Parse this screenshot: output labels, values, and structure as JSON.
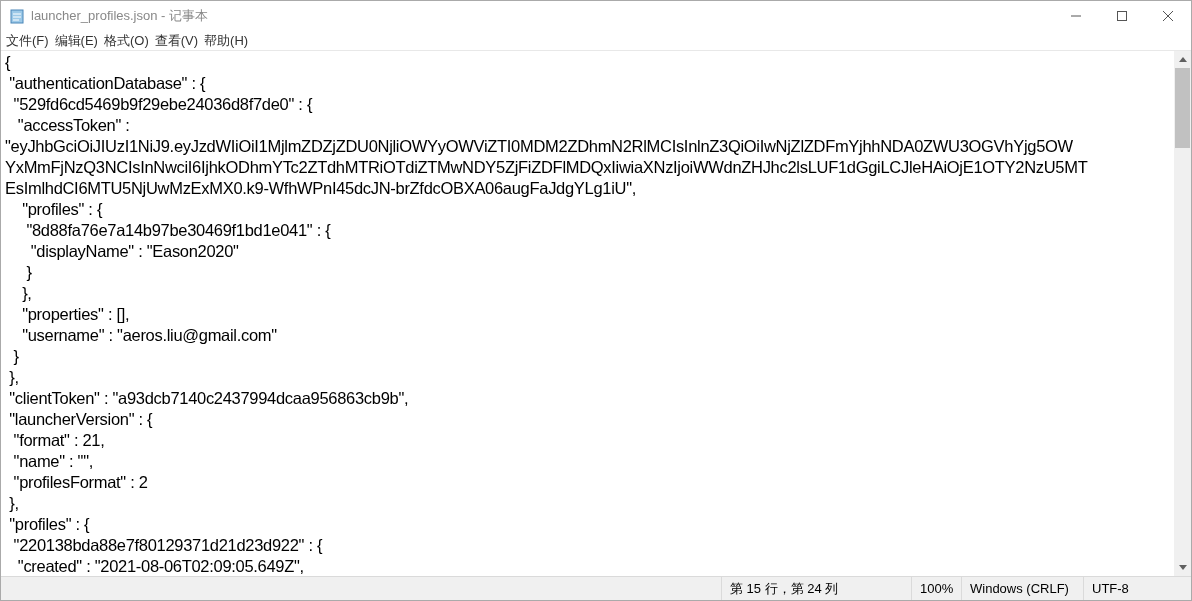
{
  "window": {
    "title": "launcher_profiles.json - 记事本"
  },
  "menu": [
    "文件(F)",
    "编辑(E)",
    "格式(O)",
    "查看(V)",
    "帮助(H)"
  ],
  "editor": {
    "lines": [
      "{",
      " \"authenticationDatabase\" : {",
      "  \"529fd6cd5469b9f29ebe24036d8f7de0\" : {",
      "   \"accessToken\" :",
      "\"eyJhbGciOiJIUzI1NiJ9.eyJzdWIiOiI1MjlmZDZjZDU0NjliOWYyOWViZTI0MDM2ZDhmN2RlMCIsInlnZ3QiOiIwNjZlZDFmYjhhNDA0ZWU3OGVhYjg5OW",
      "YxMmFjNzQ3NCIsInNwciI6IjhkODhmYTc2ZTdhMTRiOTdiZTMwNDY5ZjFiZDFlMDQxIiwiaXNzIjoiWWdnZHJhc2lsLUF1dGgiLCJleHAiOjE1OTY2NzU5MT",
      "EsImlhdCI6MTU5NjUwMzExMX0.k9-WfhWPnI45dcJN-brZfdcOBXA06augFaJdgYLg1iU\",",
      "    \"profiles\" : {",
      "     \"8d88fa76e7a14b97be30469f1bd1e041\" : {",
      "      \"displayName\" : \"Eason2020\"",
      "     }",
      "    },",
      "    \"properties\" : [],",
      "    \"username\" : \"aeros.liu@gmail.com\"",
      "  }",
      " },",
      " \"clientToken\" : \"a93dcb7140c2437994dcaa956863cb9b\",",
      " \"launcherVersion\" : {",
      "  \"format\" : 21,",
      "  \"name\" : \"\",",
      "  \"profilesFormat\" : 2",
      " },",
      " \"profiles\" : {",
      "  \"220138bda88e7f80129371d21d23d922\" : {",
      "   \"created\" : \"2021-08-06T02:09:05.649Z\","
    ]
  },
  "status_bar": {
    "position": "第 15 行，第 24 列",
    "zoom": "100%",
    "line_ending": "Windows (CRLF)",
    "encoding": "UTF-8"
  }
}
